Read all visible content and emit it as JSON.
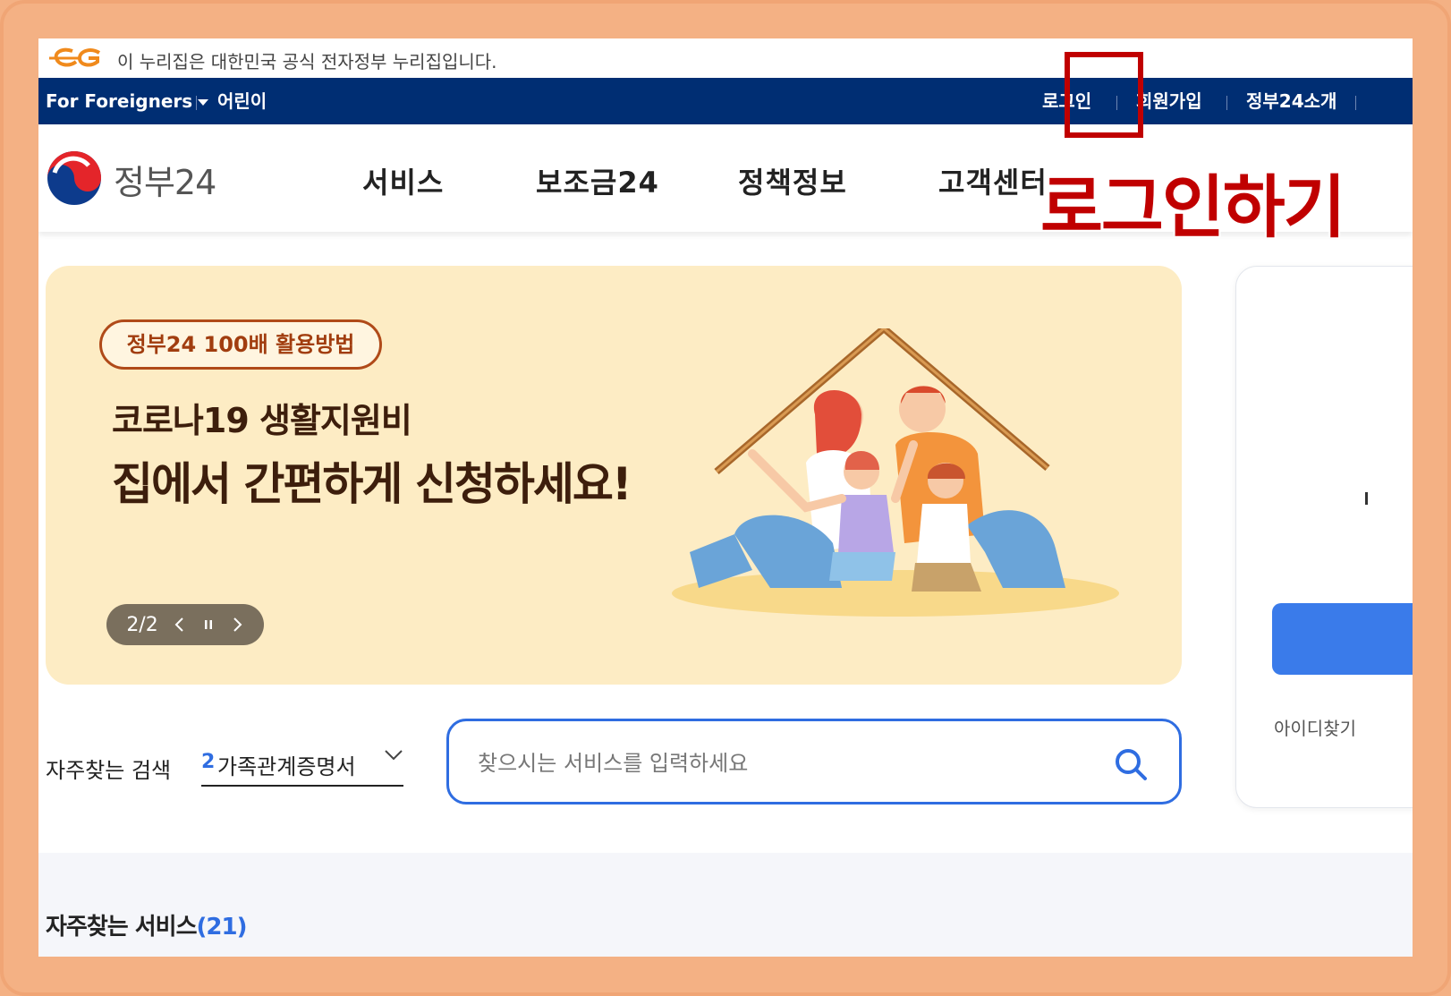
{
  "notice": {
    "text": "이 누리집은 대한민국 공식 전자정부 누리집입니다.",
    "logo_icon": "egov-logo-icon"
  },
  "util_bar": {
    "foreigners": "For Foreigners",
    "kids": "어린이",
    "login": "로그인",
    "signup": "회원가입",
    "about": "정부24소개"
  },
  "header": {
    "site_name": "정부24",
    "menu": [
      "서비스",
      "보조금24",
      "정책정보",
      "고객센터"
    ]
  },
  "annotation": {
    "text": "로그인하기",
    "color": "#c00000"
  },
  "banner": {
    "pill": "정부24 100배 활용방법",
    "line1": "코로나19 생활지원비",
    "line2": "집에서 간편하게 신청하세요!",
    "slider_page": "2/2",
    "prev_icon": "chevron-left-icon",
    "pause_icon": "pause-icon",
    "next_icon": "chevron-right-icon"
  },
  "login_panel": {
    "find_id": "아이디찾기"
  },
  "search": {
    "label": "자주찾는 검색",
    "rank": "2",
    "selected": "가족관계증명서",
    "placeholder": "찾으시는 서비스를 입력하세요"
  },
  "frequent": {
    "title": "자주찾는 서비스",
    "count": "(21)"
  },
  "colors": {
    "util_bar": "#002e73",
    "accent": "#2f6de1",
    "banner_bg": "#fdecc4",
    "frame": "#f4b184"
  }
}
